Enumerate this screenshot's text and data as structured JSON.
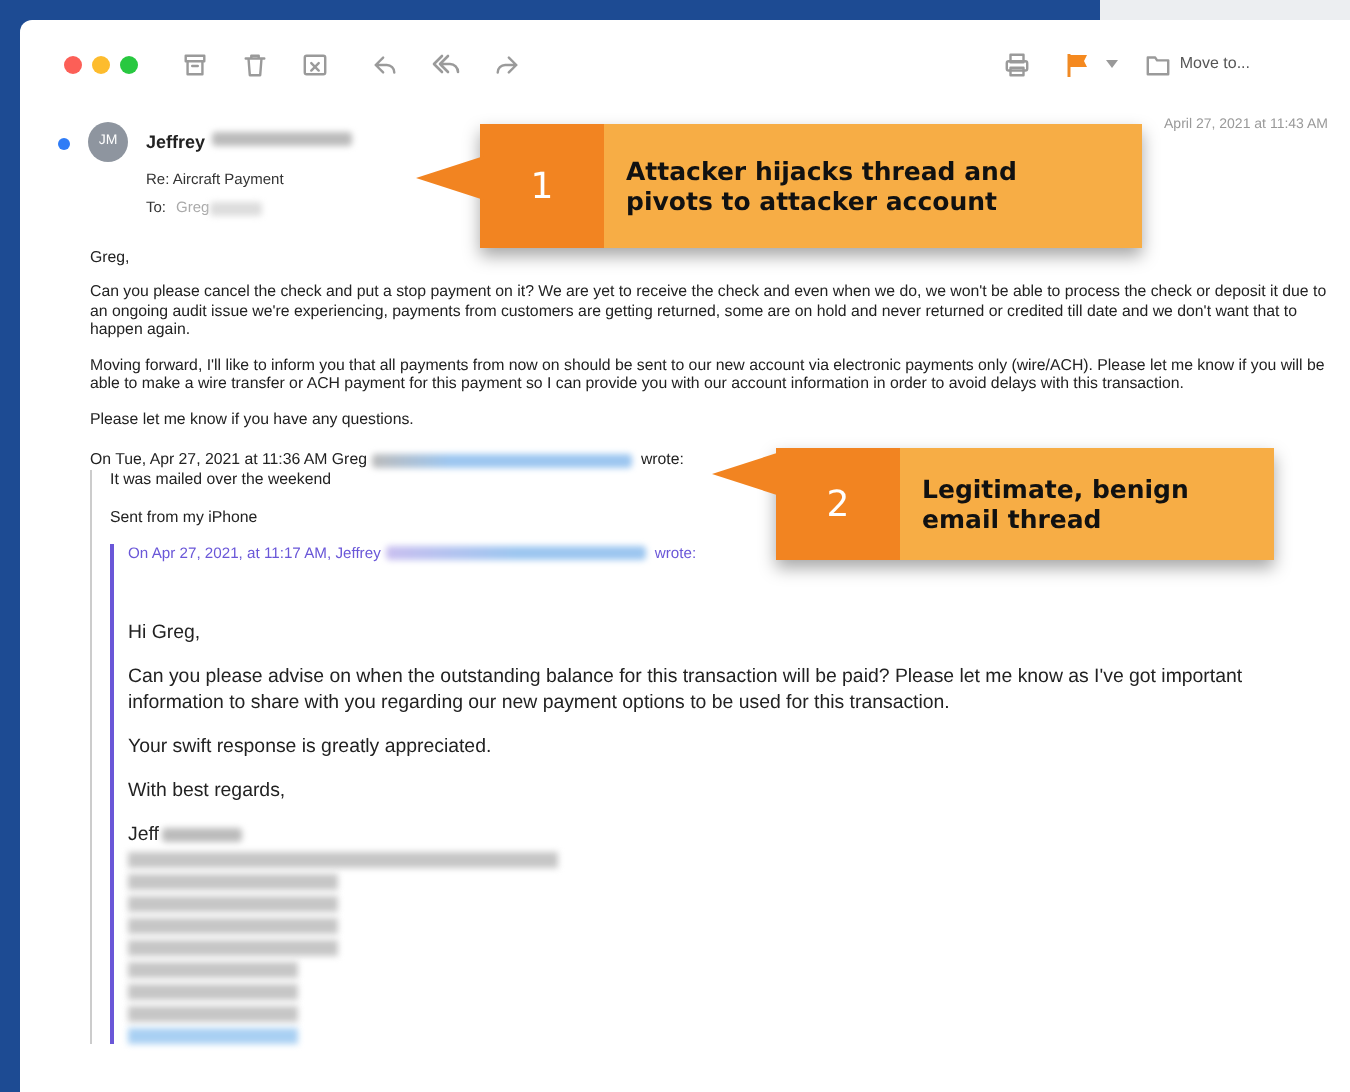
{
  "toolbar": {
    "move_to_label": "Move to..."
  },
  "message": {
    "unread": true,
    "avatar_initials": "JM",
    "sender": "Jeffrey",
    "subject": "Re: Aircraft Payment",
    "to_label": "To:",
    "to": "Greg",
    "date": "April 27, 2021 at 11:43 AM",
    "body": [
      "Greg,",
      "Can you please cancel the check and put a stop payment on it? We are yet to receive the check and even when we do, we won't be able to process the check or deposit it due to an ongoing audit issue we're experiencing, payments from customers are getting returned, some are on hold and never returned or credited till date and we don't want that to happen again.",
      "Moving forward, I'll like to inform you that all payments from now on should be sent to our new account via electronic payments only (wire/ACH). Please let me know if you will be able to make a wire transfer or ACH payment for this payment so I can provide you with our account information in order to avoid delays with this transaction.",
      "Please let me know if you have any questions."
    ],
    "quote": {
      "intro": "On Tue, Apr 27, 2021 at 11:36 AM Greg",
      "wrote": "wrote:",
      "lines": [
        "It was mailed over the weekend",
        "Sent from my iPhone"
      ],
      "nested": {
        "intro": "On Apr 27, 2021, at 11:17 AM, Jeffrey",
        "wrote": "wrote:",
        "lines": [
          "Hi Greg,",
          "Can you please advise on when the outstanding balance for this transaction will be paid? Please let me know as I've got important information to share with you regarding our new payment options to be used for this transaction.",
          "Your swift response is greatly appreciated.",
          "With best regards,"
        ],
        "signature": "Jeff"
      }
    }
  },
  "callouts": [
    {
      "number": "1",
      "text": "Attacker hijacks thread and pivots to attacker account"
    },
    {
      "number": "2",
      "text": "Legitimate, benign email thread"
    }
  ]
}
